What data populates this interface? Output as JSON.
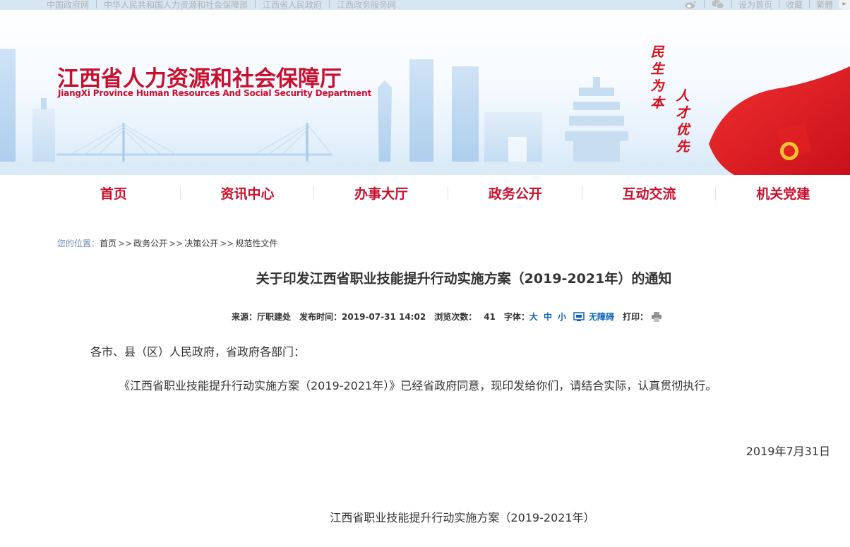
{
  "topbar": {
    "links": [
      "中国政府网",
      "中华人民共和国人力资源和社会保障部",
      "江西省人民政府",
      "江西政务服务网"
    ],
    "right_links": [
      "设为首页",
      "收藏",
      "繁體"
    ],
    "icons": [
      "weibo-icon",
      "wechat-icon"
    ]
  },
  "header": {
    "title_cn": "江西省人力资源和社会保障厅",
    "title_en": "JiangXi Province Human Resources And Social Security Department",
    "slogan_left": "民生为本",
    "slogan_right": "人才优先"
  },
  "nav": {
    "items": [
      "首页",
      "资讯中心",
      "办事大厅",
      "政务公开",
      "互动交流",
      "机关党建"
    ]
  },
  "breadcrumb": {
    "lead": "您的位置：",
    "items": [
      "首页",
      "政务公开",
      "决策公开",
      "规范性文件"
    ],
    "separator": ">>"
  },
  "article": {
    "title": "关于印发江西省职业技能提升行动实施方案（2019-2021年）的通知",
    "meta": {
      "source_label": "来源：",
      "source": "厅职建处",
      "date_label": "发布时间：",
      "date": "2019-07-31 14:02",
      "views_label": "浏览次数：",
      "views": "41",
      "font_label": "字体：",
      "font_large": "大",
      "font_medium": "中",
      "font_small": "小",
      "accessibility": "无障碍",
      "print_label": "打印："
    },
    "paragraphs": [
      "各市、县（区）人民政府，省政府各部门：",
      "《江西省职业技能提升行动实施方案（2019-2021年）》已经省政府同意，现印发给你们，请结合实际，认真贯彻执行。",
      "2019年7月31日",
      "江西省职业技能提升行动实施方案（2019-2021年）"
    ]
  },
  "colors": {
    "brand_red": "#c8102e",
    "link_blue": "#0b63b8",
    "topbar_bg": "#d7e6f3"
  }
}
